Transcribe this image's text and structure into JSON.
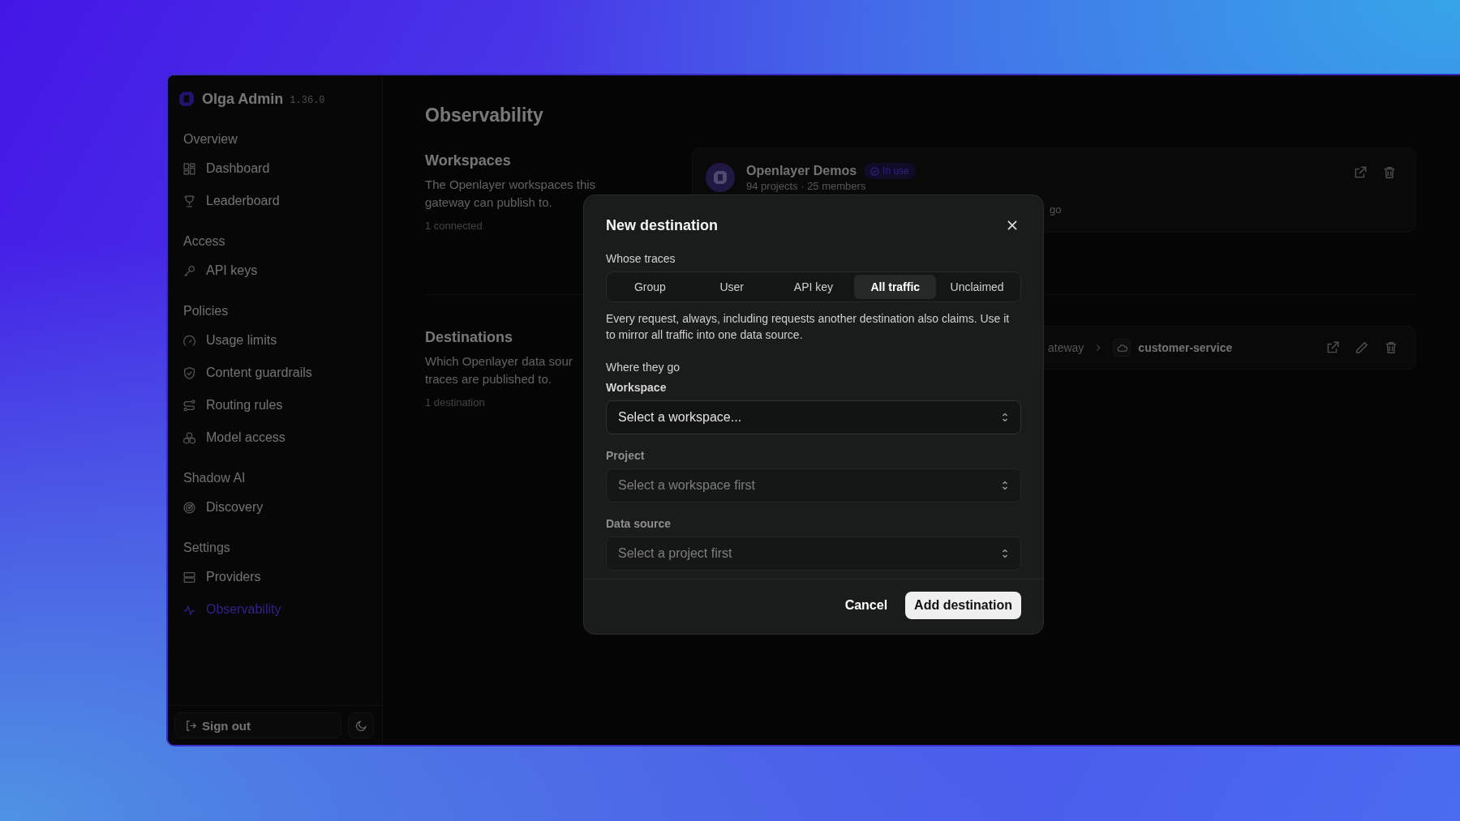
{
  "sidebar": {
    "brand": {
      "name": "Olga Admin",
      "version": "1.36.0"
    },
    "sections": [
      {
        "title": "Overview",
        "items": [
          {
            "label": "Dashboard",
            "selected": false
          },
          {
            "label": "Leaderboard",
            "selected": false
          }
        ]
      },
      {
        "title": "Access",
        "items": [
          {
            "label": "API keys",
            "selected": false
          }
        ]
      },
      {
        "title": "Policies",
        "items": [
          {
            "label": "Usage limits",
            "selected": false
          },
          {
            "label": "Content guardrails",
            "selected": false
          },
          {
            "label": "Routing rules",
            "selected": false
          },
          {
            "label": "Model access",
            "selected": false
          }
        ]
      },
      {
        "title": "Shadow AI",
        "items": [
          {
            "label": "Discovery",
            "selected": false
          }
        ]
      },
      {
        "title": "Settings",
        "items": [
          {
            "label": "Providers",
            "selected": false
          },
          {
            "label": "Observability",
            "selected": true
          }
        ]
      }
    ],
    "sign_out": "Sign out"
  },
  "main": {
    "title": "Observability",
    "workspaces": {
      "title": "Workspaces",
      "description": "The Openlayer workspaces this gateway can publish to.",
      "meta": "1 connected",
      "card": {
        "name": "Openlayer Demos",
        "badge": "In use",
        "subtitle": "94 projects · 25 members",
        "detail": "go"
      }
    },
    "destinations": {
      "title": "Destinations",
      "description_lines": [
        "Which Openlayer data sour",
        "traces are published to."
      ],
      "meta": "1 destination",
      "card": {
        "path": "ateway",
        "target": "customer-service"
      }
    }
  },
  "modal": {
    "title": "New destination",
    "traces_label": "Whose traces",
    "tabs": [
      {
        "label": "Group",
        "selected": false
      },
      {
        "label": "User",
        "selected": false
      },
      {
        "label": "API key",
        "selected": false
      },
      {
        "label": "All traffic",
        "selected": true
      },
      {
        "label": "Unclaimed",
        "selected": false
      }
    ],
    "description": "Every request, always, including requests another destination also claims. Use it to mirror all traffic into one data source.",
    "where_label": "Where they go",
    "fields": [
      {
        "label": "Workspace",
        "placeholder": "Select a workspace...",
        "disabled": false
      },
      {
        "label": "Project",
        "placeholder": "Select a workspace first",
        "disabled": true
      },
      {
        "label": "Data source",
        "placeholder": "Select a project first",
        "disabled": true
      }
    ],
    "cancel": "Cancel",
    "submit": "Add destination"
  }
}
